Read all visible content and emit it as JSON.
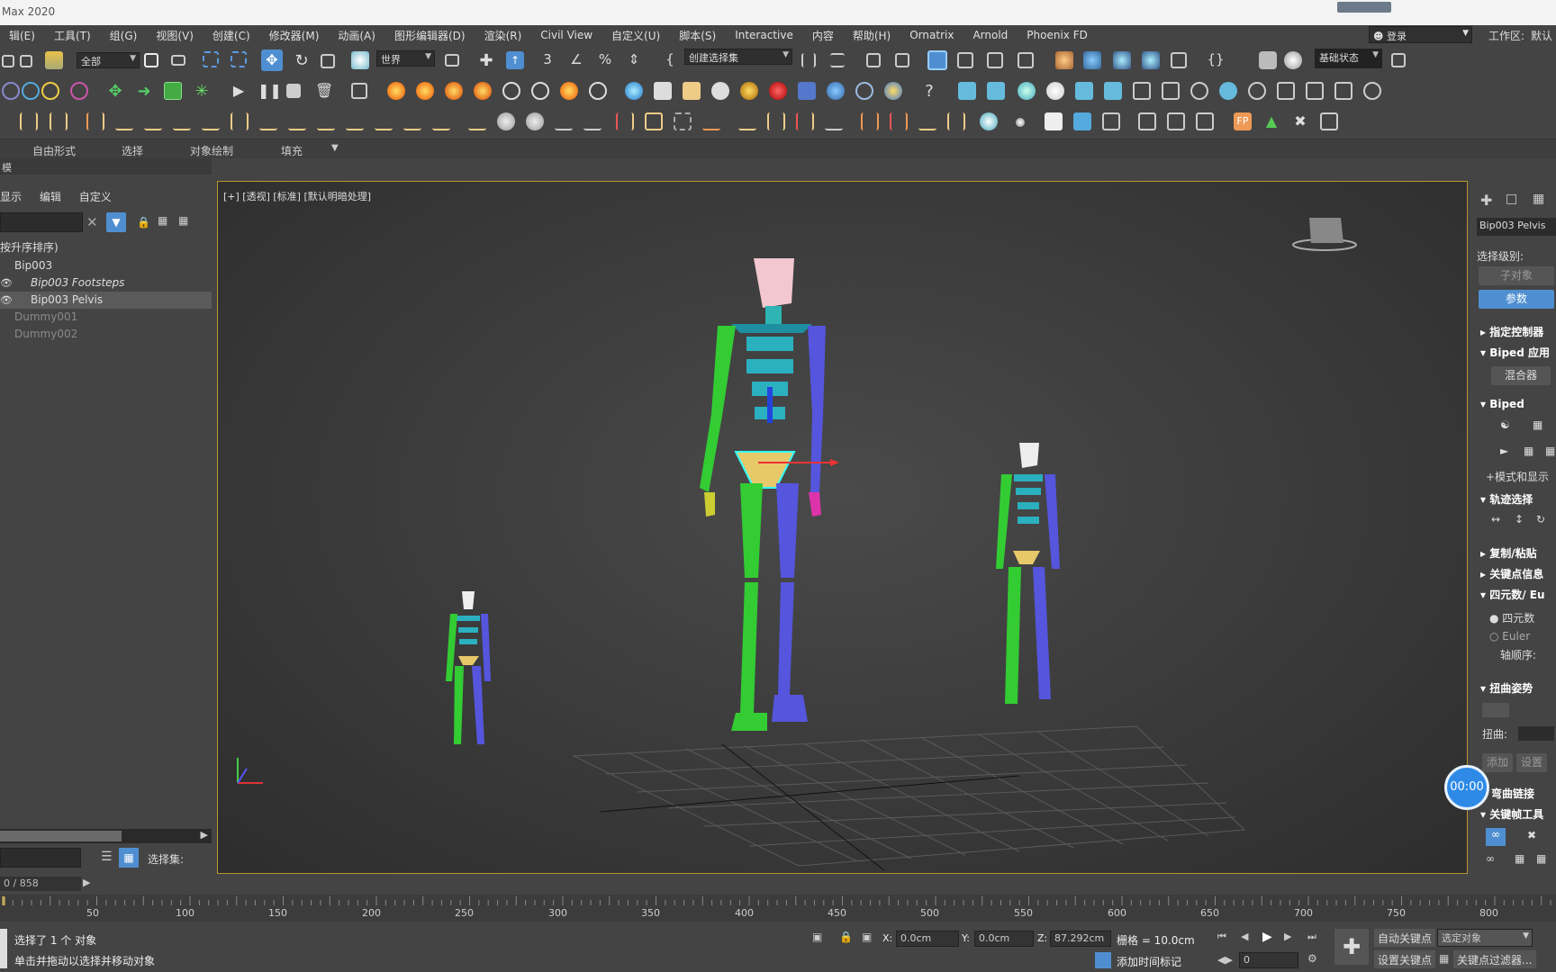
{
  "window": {
    "title": "Max 2020"
  },
  "menu": [
    "辑(E)",
    "工具(T)",
    "组(G)",
    "视图(V)",
    "创建(C)",
    "修改器(M)",
    "动画(A)",
    "图形编辑器(D)",
    "渲染(R)",
    "Civil View",
    "自定义(U)",
    "脚本(S)",
    "Interactive",
    "内容",
    "帮助(H)",
    "Ornatrix",
    "Arnold",
    "Phoenix FD"
  ],
  "login": "登录",
  "workspace": {
    "label": "工作区:",
    "value": "默认"
  },
  "toolbar": {
    "filter": "全部",
    "coord_system": "世界",
    "selection_set": "创建选择集",
    "base_state": "基础状态"
  },
  "ribbon": {
    "tabs": [
      "自由形式",
      "选择",
      "对象绘制",
      "填充"
    ]
  },
  "left_header": "模",
  "explorer": {
    "tabs": [
      "显示",
      "编辑",
      "自定义"
    ],
    "sort_label": "按升序排序)",
    "items": [
      {
        "label": "Bip003",
        "style": "normal"
      },
      {
        "label": "Bip003 Footsteps",
        "style": "italic"
      },
      {
        "label": "Bip003 Pelvis",
        "style": "selected"
      },
      {
        "label": "Dummy001",
        "style": "dim"
      },
      {
        "label": "Dummy002",
        "style": "dim"
      }
    ],
    "selection_set_label": "选择集:"
  },
  "viewport": {
    "label": "[+] [透视] [标准] [默认明暗处理]"
  },
  "command_panel": {
    "object_name": "Bip003 Pelvis",
    "selection_level": "选择级别:",
    "btn_subobject": "子对象",
    "btn_params": "参数",
    "rollouts": {
      "assign_controller": "指定控制器",
      "biped_apps": "Biped 应用",
      "mixer": "混合器",
      "biped": "Biped",
      "mode_display": "+模式和显示",
      "track_selection": "轨迹选择",
      "copy_paste": "复制/粘贴",
      "key_info": "关键点信息",
      "quat_euler": "四元数/ Eu",
      "quaternion": "四元数",
      "euler": "Euler",
      "axis_order": "轴顺序:",
      "twist_pose": "扭曲姿势",
      "twist": "扭曲:",
      "add": "添加",
      "set": "设置",
      "bend_links": "弯曲链接",
      "keyframe_tools": "关键帧工具"
    }
  },
  "timer": "00:00",
  "time": {
    "frame_display": "0 / 858",
    "ticks": [
      "50",
      "100",
      "150",
      "200",
      "250",
      "300",
      "350",
      "400",
      "450",
      "500",
      "550",
      "600",
      "650",
      "700",
      "750",
      "800"
    ]
  },
  "status": {
    "selected": "选择了 1 个 对象",
    "hint": "单击并拖动以选择并移动对象",
    "x_label": "X:",
    "x_val": "0.0cm",
    "y_label": "Y:",
    "y_val": "0.0cm",
    "z_label": "Z:",
    "z_val": "87.292cm",
    "grid": "栅格 = 10.0cm",
    "add_time_tag": "添加时间标记",
    "frame_input": "0",
    "auto_key": "自动关键点",
    "set_key": "设置关键点",
    "selected_obj": "选定对象",
    "key_filters": "关键点过滤器..."
  }
}
